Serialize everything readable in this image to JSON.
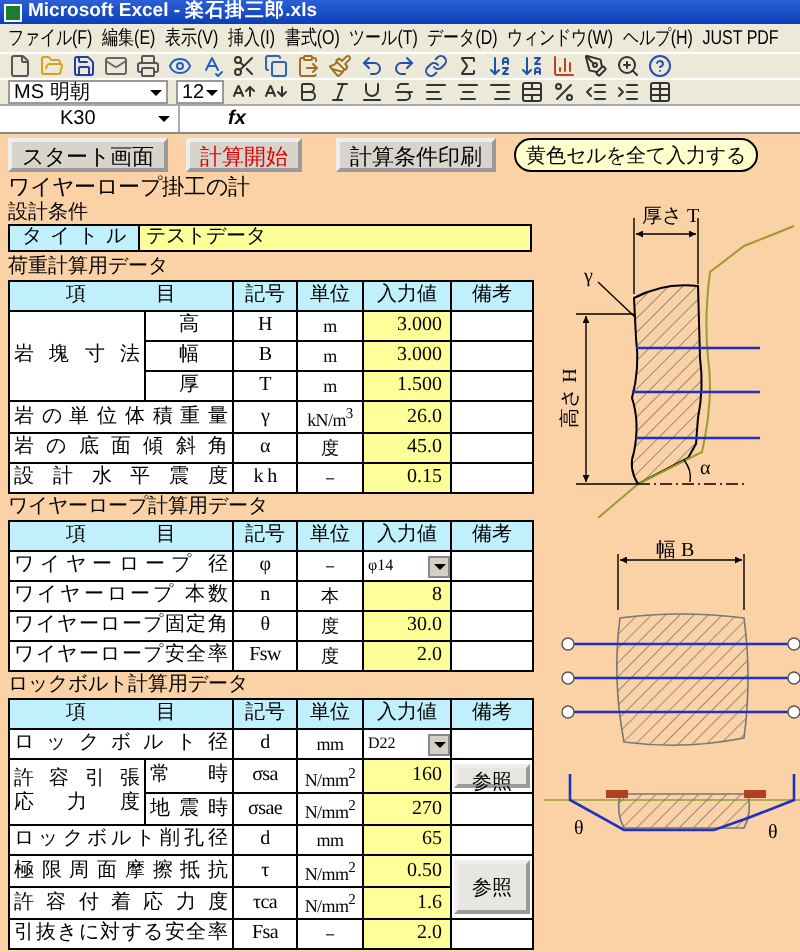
{
  "window": {
    "title": "Microsoft Excel - 楽石掛三郎.xls"
  },
  "menu": [
    "ファイル(F)",
    "編集(E)",
    "表示(V)",
    "挿入(I)",
    "書式(O)",
    "ツール(T)",
    "データ(D)",
    "ウィンドウ(W)",
    "ヘルプ(H)",
    "JUST PDF"
  ],
  "format_bar": {
    "font": "MS 明朝",
    "size": "12"
  },
  "formula_bar": {
    "name_box": "K30",
    "fx": "fx"
  },
  "buttons": [
    {
      "label": "スタート画面",
      "kind": "normal"
    },
    {
      "label": "計算開始",
      "kind": "accent"
    },
    {
      "label": "計算条件印刷",
      "kind": "normal"
    },
    {
      "label": "黄色セルを全て入力する",
      "kind": "pill"
    }
  ],
  "sheet_title": "ワイヤーロープ掛工の計",
  "design": {
    "heading": "設計条件",
    "title_label": "タイトル",
    "title_value": "テストデータ"
  },
  "tables": [
    {
      "heading": "荷重計算用データ",
      "columns": [
        "項目",
        "記号",
        "単位",
        "入力値",
        "備考"
      ],
      "rows": [
        {
          "group": [
            "岩塊寸法"
          ],
          "rows": [
            {
              "sub": "高",
              "symbol": "H",
              "unit": "m",
              "value": "3.000",
              "kind": "yellow"
            },
            {
              "sub": "幅",
              "symbol": "B",
              "unit": "m",
              "value": "3.000",
              "kind": "yellow"
            },
            {
              "sub": "厚",
              "symbol": "T",
              "unit": "m",
              "value": "1.500",
              "kind": "yellow"
            }
          ]
        },
        {
          "label": "岩の単位体積重量",
          "symbol": "γ",
          "unit": "kN/m$^{3}$",
          "value": "26.0",
          "kind": "yellow"
        },
        {
          "label": "岩の底面傾斜角",
          "symbol": "α",
          "unit": "度",
          "value": "45.0",
          "kind": "yellow"
        },
        {
          "label": "設計水平震度",
          "symbol": "k h",
          "unit": "－",
          "value": "0.15",
          "kind": "yellow"
        }
      ]
    },
    {
      "heading": "ワイヤーロープ計算用データ",
      "columns": [
        "項目",
        "記号",
        "単位",
        "入力値",
        "備考"
      ],
      "rows": [
        {
          "label": "ワイヤーロープ 径",
          "symbol": "φ",
          "unit": "－",
          "value": "φ14",
          "kind": "dropdown"
        },
        {
          "label": "ワイヤーロープ 本数",
          "symbol": "n",
          "unit": "本",
          "value": "8",
          "kind": "yellow"
        },
        {
          "label": "ワイヤーロープ固定角",
          "symbol": "θ",
          "unit": "度",
          "value": "30.0",
          "kind": "yellow"
        },
        {
          "label": "ワイヤーロープ安全率",
          "symbol": "Fsw",
          "unit": "度",
          "value": "2.0",
          "kind": "yellow"
        }
      ]
    },
    {
      "heading": "ロックボルト計算用データ",
      "columns": [
        "項目",
        "記号",
        "単位",
        "入力値",
        "備考"
      ],
      "rows": [
        {
          "label": "ロックボルト径",
          "symbol": "d",
          "unit": "mm",
          "value": "D22",
          "kind": "dropdown"
        },
        {
          "group": [
            "許容引張",
            "応力度"
          ],
          "rows": [
            {
              "sub": "常時",
              "symbol": "σsa",
              "unit": "N/mm$^{2}$",
              "value": "160",
              "kind": "yellow",
              "note": {
                "label": "参照",
                "kind": "single"
              }
            },
            {
              "sub": "地震時",
              "symbol": "σsae",
              "unit": "N/mm$^{2}$",
              "value": "270",
              "kind": "yellow"
            }
          ]
        },
        {
          "label": "ロックボルト削孔径",
          "symbol": "d",
          "unit": "mm",
          "value": "65",
          "kind": "yellow"
        },
        {
          "label": "極限周面摩擦抵抗",
          "symbol": "τ",
          "unit": "N/mm$^{2}$",
          "value": "0.50",
          "kind": "yellow",
          "note": {
            "label": "参照",
            "kind": "tall"
          }
        },
        {
          "label": "許容付着応力度",
          "symbol": "τca",
          "unit": "N/mm$^{2}$",
          "value": "1.6",
          "kind": "yellow"
        },
        {
          "label": "引抜きに対する安全率",
          "symbol": "Fsa",
          "unit": "－",
          "value": "2.0",
          "kind": "yellow"
        }
      ]
    }
  ],
  "diagrams": {
    "side": {
      "thickness": "厚さ T",
      "unit_weight": "γ",
      "height": "高さ H",
      "angle": "α"
    },
    "plan": {
      "width": "幅 B"
    },
    "section": {
      "angles": [
        "θ",
        "θ"
      ]
    }
  }
}
